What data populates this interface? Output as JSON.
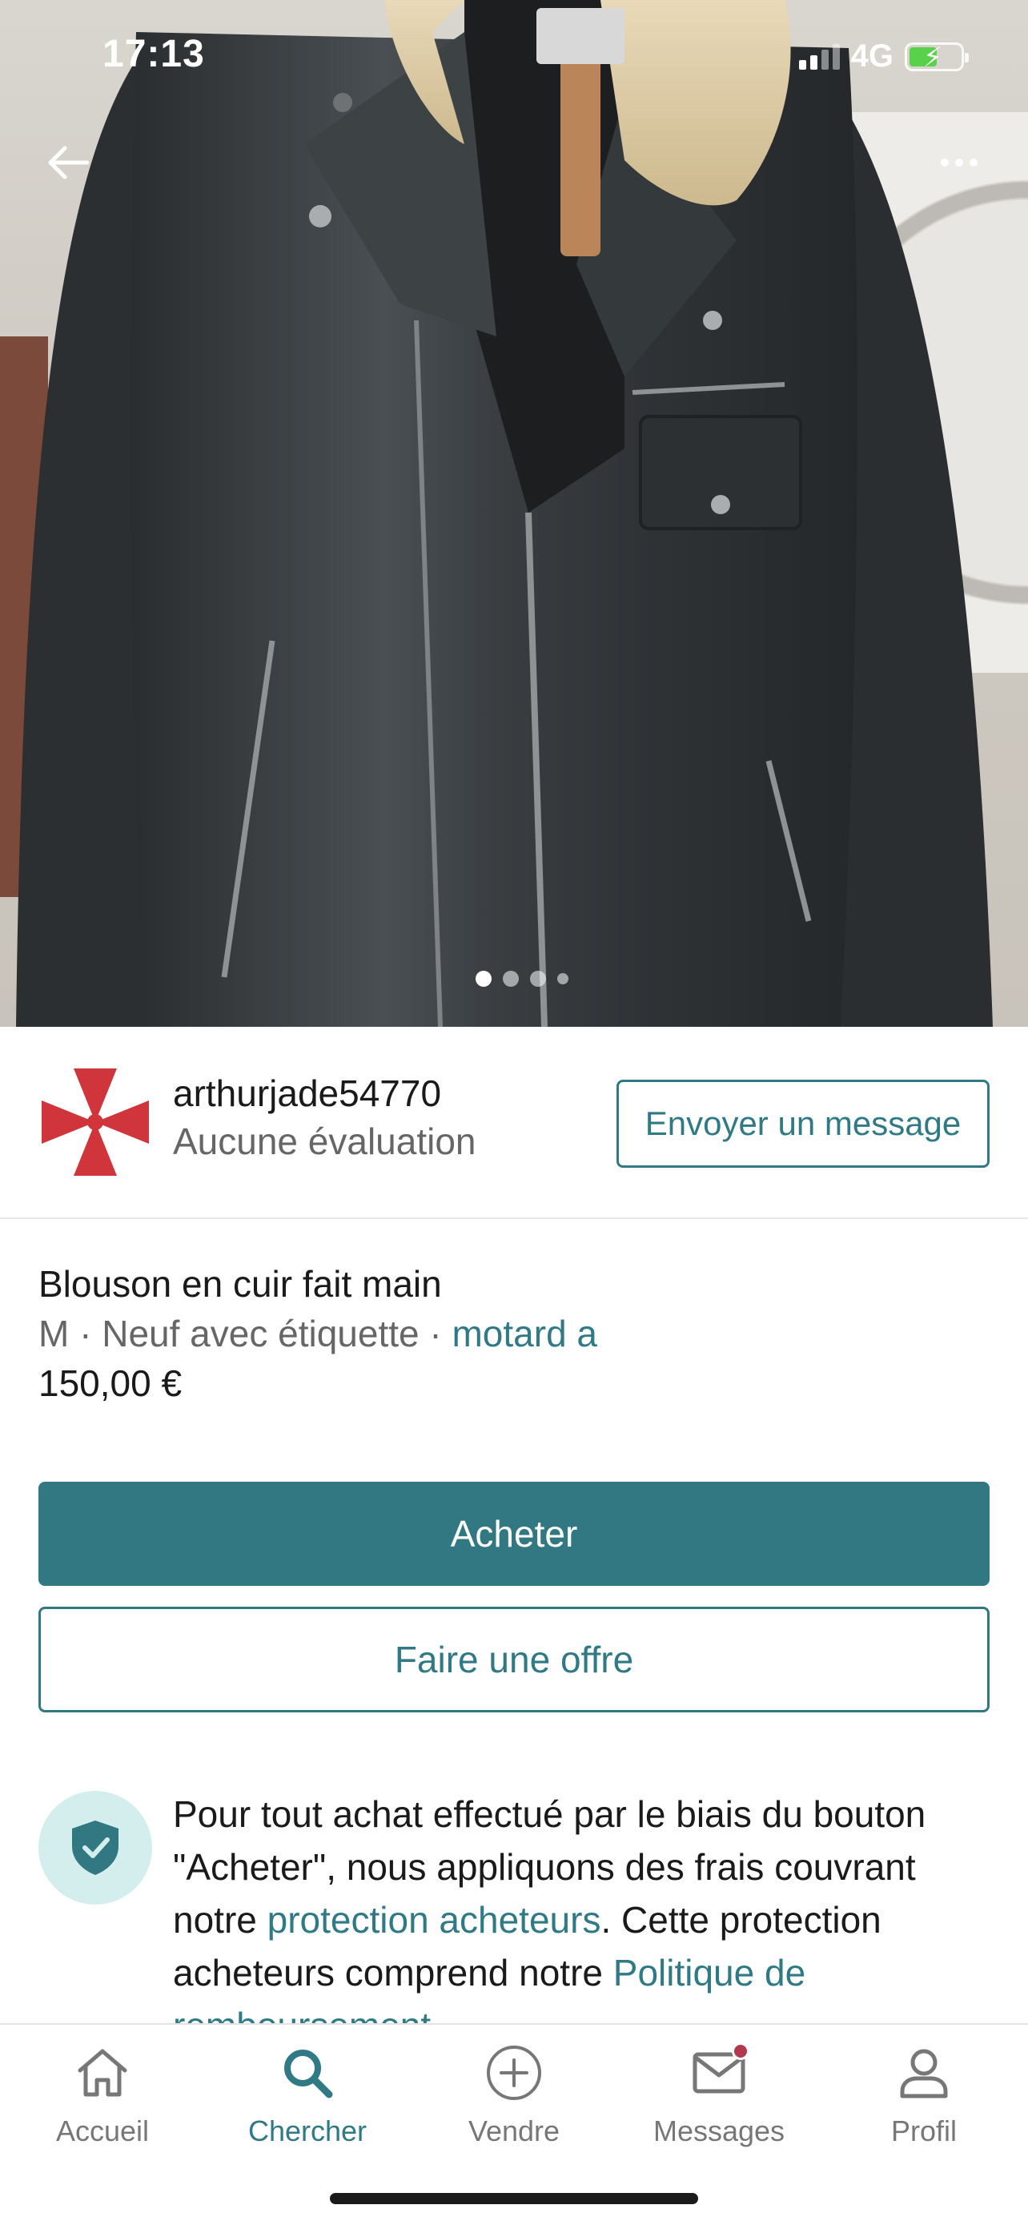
{
  "status_bar": {
    "time": "17:13",
    "network": "4G"
  },
  "carousel": {
    "total_images": 4,
    "active_index": 0
  },
  "seller": {
    "username": "arthurjade54770",
    "rating": "Aucune évaluation",
    "message_button": "Envoyer un message",
    "avatar_color": "#d0353b"
  },
  "item": {
    "title": "Blouson en cuir fait main",
    "size": "M",
    "separator": " · ",
    "condition": "Neuf avec étiquette",
    "brand": "motard a",
    "price": "150,00 €"
  },
  "actions": {
    "buy": "Acheter",
    "offer": "Faire une offre"
  },
  "protection": {
    "text_1": "Pour tout achat effectué par le biais du bouton \"Acheter\", nous appliquons des frais couvrant notre ",
    "link_1": "protection acheteurs",
    "text_2": ". Cette protection acheteurs comprend notre ",
    "link_2": "Politique de remboursement"
  },
  "tabbar": {
    "home": "Accueil",
    "search": "Chercher",
    "sell": "Vendre",
    "messages": "Messages",
    "profile": "Profil"
  },
  "colors": {
    "accent": "#327882",
    "link": "#2f7a85",
    "notification": "#b3384b"
  }
}
